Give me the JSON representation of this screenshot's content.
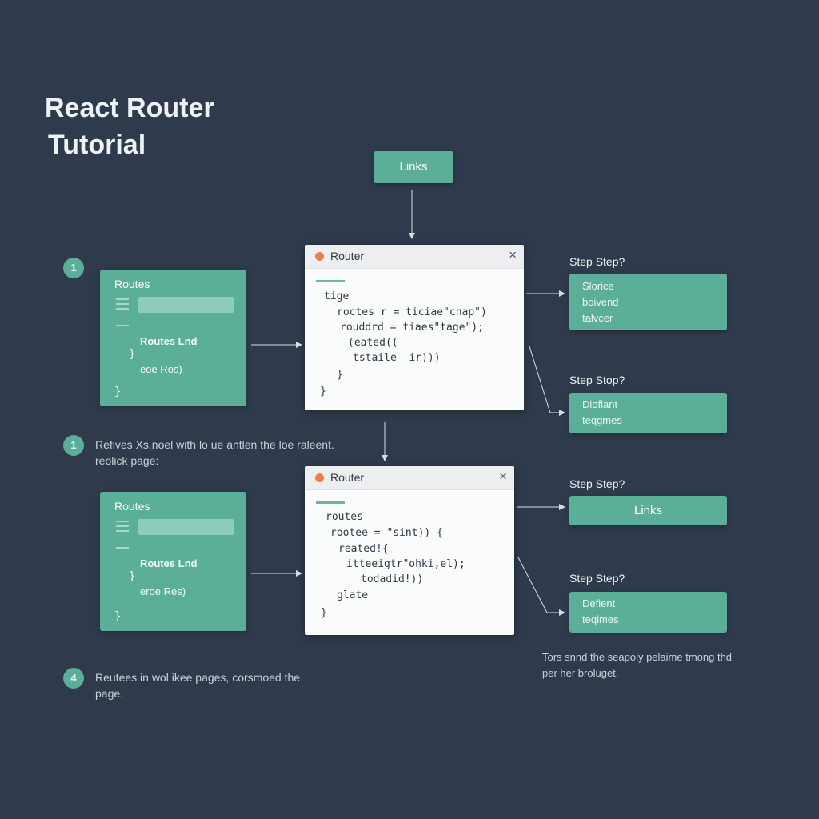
{
  "title": {
    "line1": "React Router",
    "line2": "Tutorial"
  },
  "links_top": "Links",
  "badges": [
    "1",
    "1",
    "4"
  ],
  "notes": {
    "n1": [
      "Refives Xs.noel with lo ue antlen the loe raleent.",
      "reolick page:"
    ],
    "n2": [
      "Reutees in wol ikee pages, corsmoed the",
      "page."
    ],
    "bottom": [
      "Tors snnd the seapoly pelaime tmong thd",
      "per her broluget."
    ]
  },
  "routes_cards": [
    {
      "title": "Routes",
      "line1": "Routes Lnd",
      "brace_open": "}",
      "line2": "eoe Ros)",
      "brace_close": "}"
    },
    {
      "title": "Routes",
      "line1": "Routes Lnd",
      "brace_open": "}",
      "line2": "eroe Res)",
      "brace_close": "}"
    }
  ],
  "code_cards": [
    {
      "title": "Router",
      "lines": [
        "tige",
        "roctes r = ticiae\"cnap\")",
        "rouddrd = tiaes\"tage\");",
        "(eated((",
        "tstaile -ir)))",
        "}",
        "}"
      ]
    },
    {
      "title": "Router",
      "lines": [
        "routes",
        "rootee = \"sint)) {",
        "reated!{",
        "itteeigtr\"ohki,el);",
        "todadid!))",
        "glate",
        "}"
      ]
    }
  ],
  "steps": [
    {
      "label": "Step Step?",
      "lines": [
        "Slorice",
        "boivend",
        "talvcer"
      ]
    },
    {
      "label": "Step Stop?",
      "lines": [
        "Diofiant",
        "teqgmes"
      ]
    },
    {
      "label": "Step Step?",
      "lines": [
        "Links"
      ]
    },
    {
      "label": "Step Step?",
      "lines": [
        "Defient",
        "teqimes"
      ]
    }
  ],
  "colors": {
    "background": "#2f3b4c",
    "accent_green": "#5bae97",
    "window_dot": "#ef7d4a",
    "card": "#fafbfb"
  },
  "icons": [
    "window-dot-icon",
    "close-icon",
    "hamburger-icon",
    "arrow-icon"
  ]
}
